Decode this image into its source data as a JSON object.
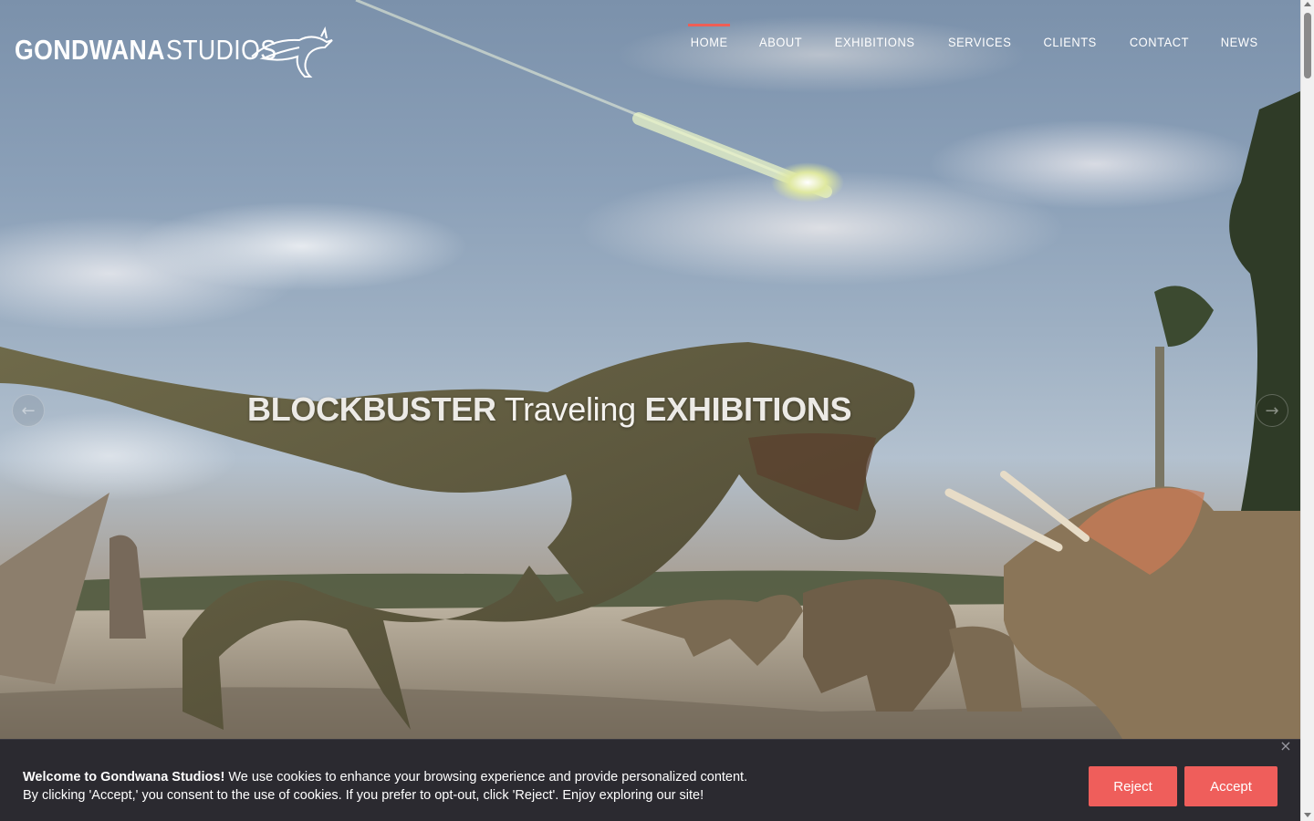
{
  "brand": {
    "name_bold": "GONDWANA",
    "name_light": "STUDIOS",
    "mark_icon": "kangaroo-logo-icon"
  },
  "nav": {
    "items": [
      {
        "label": "HOME",
        "active": true
      },
      {
        "label": "ABOUT",
        "active": false
      },
      {
        "label": "EXHIBITIONS",
        "active": false
      },
      {
        "label": "SERVICES",
        "active": false
      },
      {
        "label": "CLIENTS",
        "active": false
      },
      {
        "label": "CONTACT",
        "active": false
      },
      {
        "label": "NEWS",
        "active": false
      }
    ],
    "active_color": "#ef5e55"
  },
  "hero": {
    "headline_part1": "BLOCKBUSTER",
    "headline_part2": "Traveling",
    "headline_part3": "EXHIBITIONS",
    "prev_icon": "arrow-left-icon",
    "next_icon": "arrow-right-icon",
    "prev_glyph": "←",
    "next_glyph": "→"
  },
  "cookie": {
    "title": "Welcome to Gondwana Studios!",
    "line1": "We use cookies to enhance your browsing experience and provide personalized content.",
    "line2": "By clicking 'Accept,' you consent to the use of cookies. If you prefer to opt-out, click 'Reject'. Enjoy exploring our site!",
    "reject_label": "Reject",
    "accept_label": "Accept",
    "close_glyph": "×",
    "button_color": "#ef5e5b",
    "background": "#2b2a30"
  }
}
